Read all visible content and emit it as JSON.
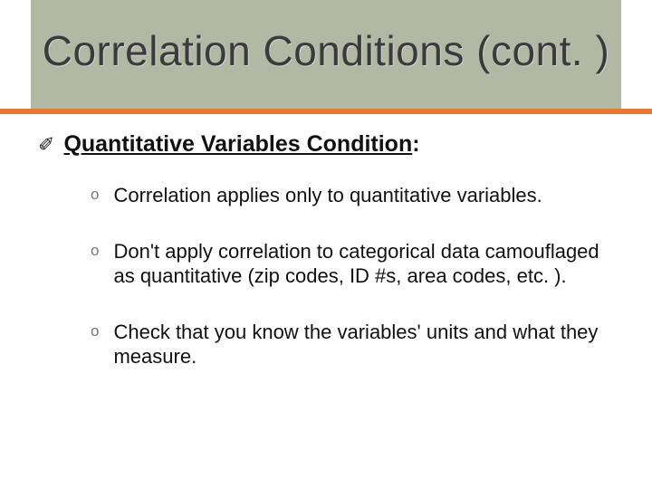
{
  "slide": {
    "title": "Correlation Conditions (cont. )",
    "bullet": {
      "marker": "✐",
      "label": "Quantitative Variables Condition",
      "colon": ":"
    },
    "subitems": [
      {
        "marker": "o",
        "text": "Correlation applies only to quantitative variables."
      },
      {
        "marker": "o",
        "text": "Don't apply correlation to categorical data camouflaged as quantitative (zip codes, ID #s, area codes, etc. )."
      },
      {
        "marker": "o",
        "text": "Check that you know the variables' units and what they measure."
      }
    ]
  }
}
